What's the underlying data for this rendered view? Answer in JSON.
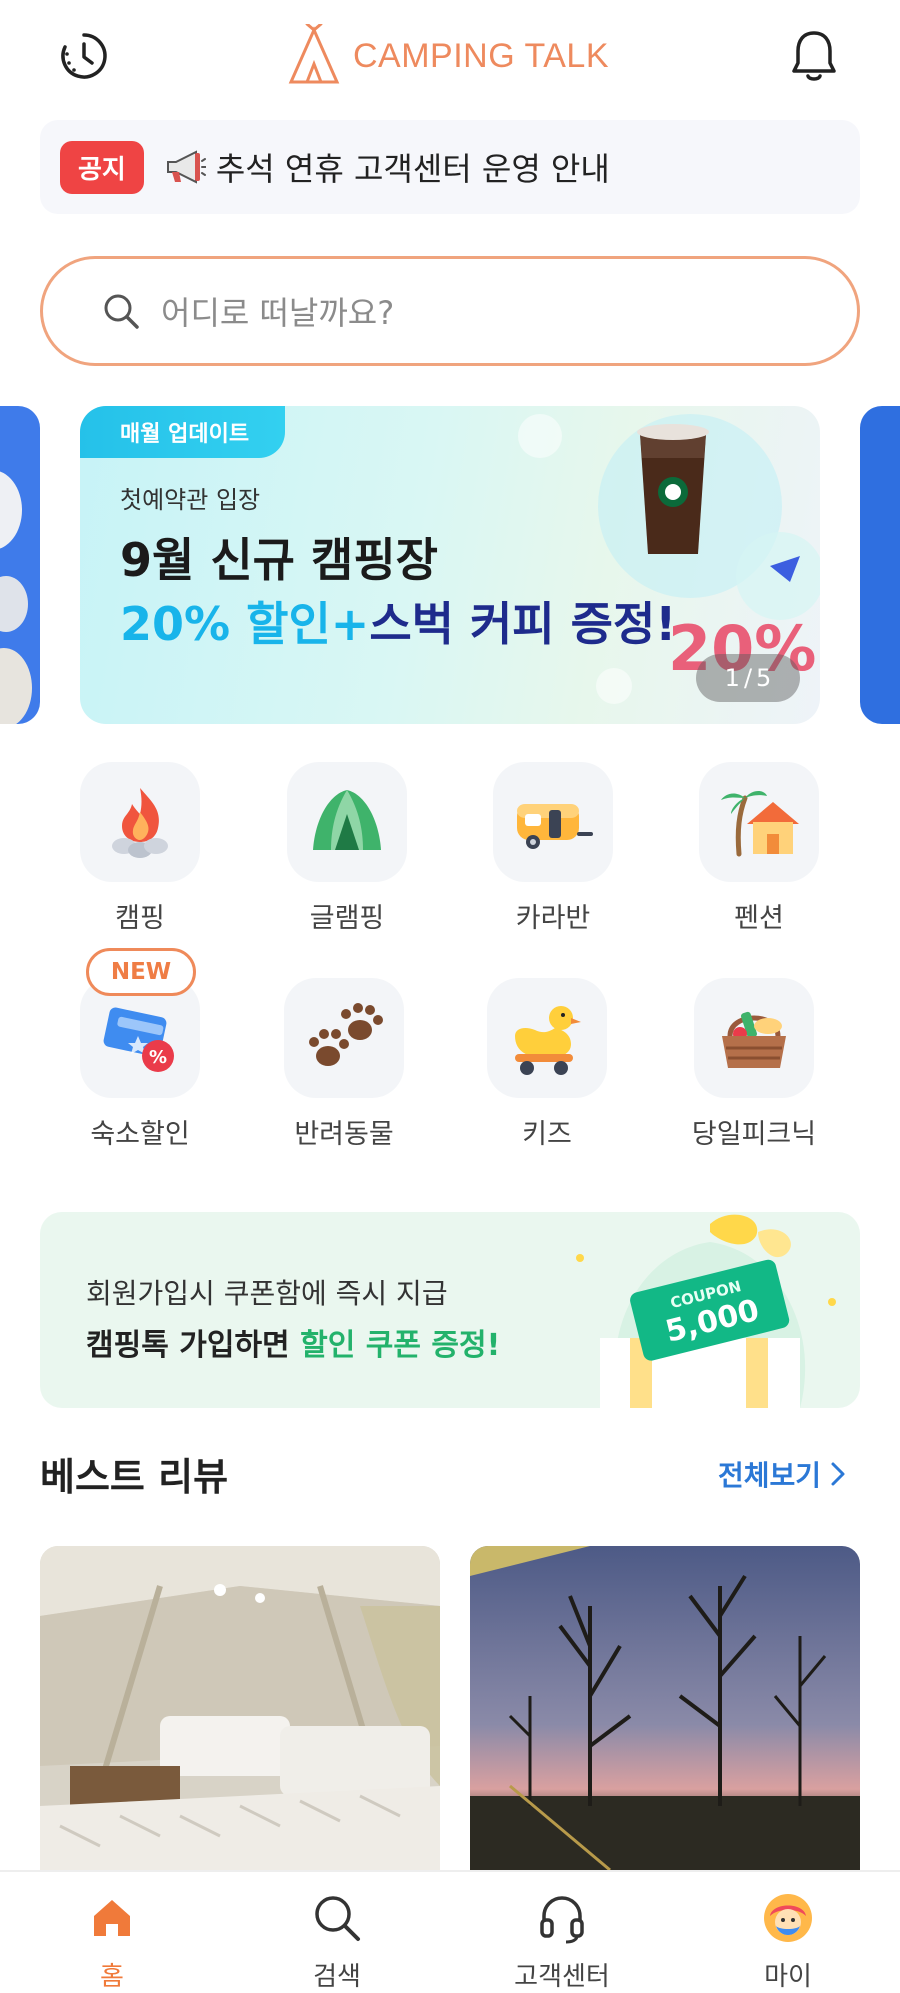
{
  "header": {
    "logo_text": "CAMPING TALK",
    "history_icon": "clock-history-icon",
    "notification_icon": "bell-icon"
  },
  "notice": {
    "badge": "공지",
    "icon": "megaphone-icon",
    "text": "추석 연휴 고객센터 운영 안내"
  },
  "search": {
    "placeholder": "어디로 떠날까요?",
    "icon": "search-icon"
  },
  "banner": {
    "tag": "매월 업데이트",
    "subtitle": "첫예약관 입장",
    "title": "9월 신규 캠핑장",
    "highlight1": "20% 할인",
    "plus": "+",
    "highlight2": "스벅 커피 증정!",
    "decor_text": "20%",
    "page_current": "1",
    "page_sep": "/",
    "page_total": "5"
  },
  "categories": [
    {
      "label": "캠핑",
      "icon": "campfire-icon"
    },
    {
      "label": "글램핑",
      "icon": "tent-icon"
    },
    {
      "label": "카라반",
      "icon": "caravan-icon"
    },
    {
      "label": "펜션",
      "icon": "pension-house-icon"
    },
    {
      "label": "숙소할인",
      "icon": "discount-ticket-icon",
      "badge": "NEW"
    },
    {
      "label": "반려동물",
      "icon": "paw-icon"
    },
    {
      "label": "키즈",
      "icon": "duck-toy-icon"
    },
    {
      "label": "당일피크닉",
      "icon": "picnic-basket-icon"
    }
  ],
  "coupon_banner": {
    "line1": "회원가입시 쿠폰함에 즉시 지급",
    "line2_prefix": "캠핑톡 가입하면 ",
    "line2_highlight": "할인 쿠폰 증정!",
    "coupon_word": "COUPON",
    "coupon_amount": "5,000"
  },
  "best_reviews": {
    "title": "베스트 리뷰",
    "see_all": "전체보기"
  },
  "tabbar": [
    {
      "label": "홈",
      "icon": "home-icon",
      "active": true
    },
    {
      "label": "검색",
      "icon": "search-icon"
    },
    {
      "label": "고객센터",
      "icon": "headset-icon"
    },
    {
      "label": "마이",
      "icon": "avatar-icon"
    }
  ],
  "colors": {
    "brand": "#ee8a5e",
    "notice_badge": "#ef4444",
    "link_blue": "#2b78d6",
    "coupon_green": "#23b26b",
    "tab_active": "#f07a3a"
  }
}
